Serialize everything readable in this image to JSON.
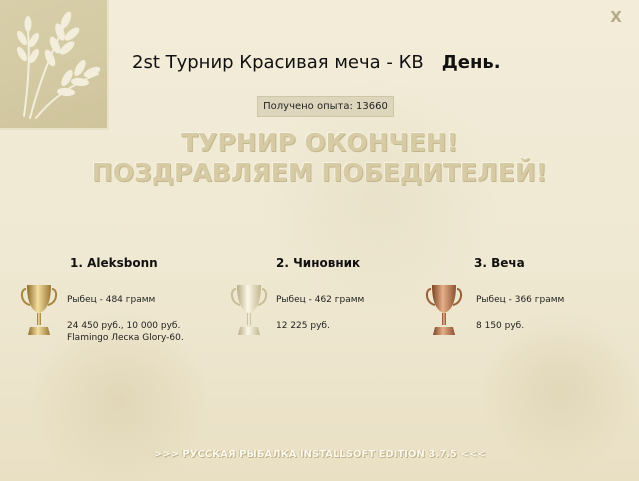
{
  "window": {
    "close_label": "X",
    "title": "2st Турнир Красивая меча - КВ",
    "day": "День."
  },
  "experience": "Получено опыта: 13660",
  "banner": {
    "line1": "ТУРНИР ОКОНЧЕН!",
    "line2": "ПОЗДРАВЛЯЕМ ПОБЕДИТЕЛЕЙ!"
  },
  "winners": [
    {
      "name": "1. Aleksbonn",
      "fish": "Рыбец - 484 грамм",
      "prize": "24 450 руб., 10 000 руб.",
      "prize2": "Flamingo Леска Glory-60.",
      "cup_color": "#c9a85a"
    },
    {
      "name": "2. Чиновник",
      "fish": "Рыбец - 462 грамм",
      "prize": "12 225 руб.",
      "prize2": "",
      "cup_color": "#d8d0b0"
    },
    {
      "name": "3. Веча",
      "fish": "Рыбец - 366 грамм",
      "prize": "8 150 руб.",
      "prize2": "",
      "cup_color": "#b87a4e"
    }
  ],
  "footer": ">>> РУССКАЯ РЫБАЛКА INSTALLSOFT EDITION 3.7.5 <<<",
  "icons": [
    "wheat-logo-icon",
    "close-icon",
    "gold-cup-icon",
    "silver-cup-icon",
    "bronze-cup-icon"
  ]
}
